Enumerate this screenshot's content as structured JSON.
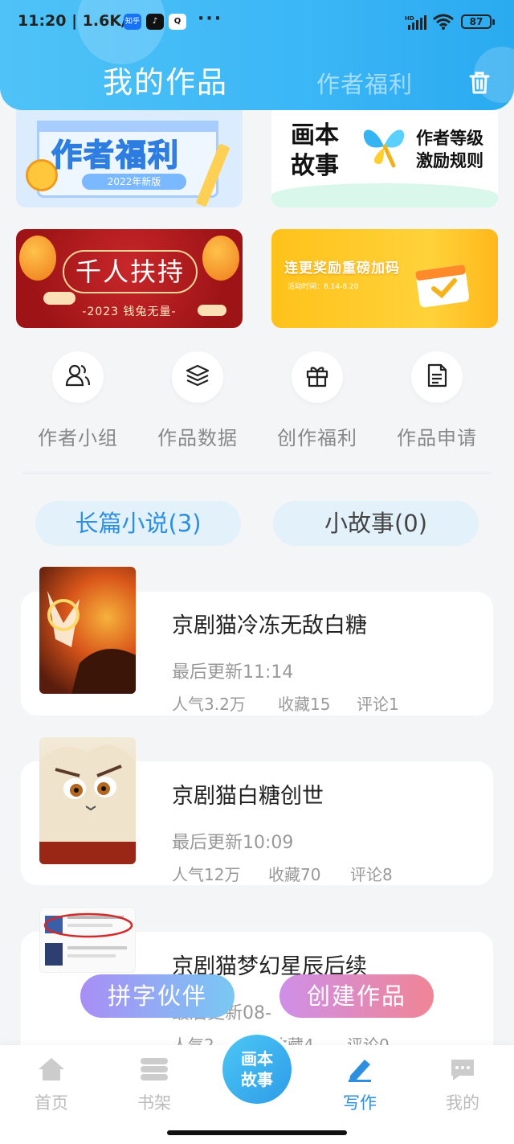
{
  "status_bar": {
    "time": "11:20",
    "speed": "1.6K/s",
    "app1": "知乎",
    "app2": "♪",
    "app3": "Q",
    "more": "···",
    "network": "HD",
    "battery": "87"
  },
  "header": {
    "tab_active": "我的作品",
    "tab_inactive": "作者福利"
  },
  "banners": {
    "b1": {
      "title": "作者福利",
      "sub": "2022年新版"
    },
    "b2": {
      "logo": "画本故事",
      "text_line1": "作者等级",
      "text_line2": "激励规则"
    },
    "b3": {
      "title": "千人扶持",
      "sub": "-2023 钱兔无量-"
    },
    "b4": {
      "title": "连更奖励重磅加码",
      "sub": "活动时间：8.14-8.20"
    }
  },
  "shortcuts": [
    {
      "label": "作者小组",
      "icon": "users-icon"
    },
    {
      "label": "作品数据",
      "icon": "layers-icon"
    },
    {
      "label": "创作福利",
      "icon": "gift-icon"
    },
    {
      "label": "作品申请",
      "icon": "document-icon"
    }
  ],
  "content_tabs": {
    "novel": "长篇小说(3)",
    "story": "小故事(0)"
  },
  "works": [
    {
      "title": "京剧猫冷冻无敌白糖",
      "update": "最后更新11:14",
      "popularity": "人气3.2万",
      "favorites": "收藏15",
      "comments": "评论1"
    },
    {
      "title": "京剧猫白糖创世",
      "update": "最后更新10:09",
      "popularity": "人气12万",
      "favorites": "收藏70",
      "comments": "评论8"
    },
    {
      "title": "京剧猫梦幻星辰后续",
      "update": "最后更新08-",
      "popularity": "人气2.",
      "favorites": "收藏4",
      "comments": "评论0"
    }
  ],
  "floating": {
    "partner": "拼字伙伴",
    "create": "创建作品"
  },
  "nav": {
    "home": "首页",
    "shelf": "书架",
    "center": "画本故事",
    "write": "写作",
    "mine": "我的"
  },
  "colors": {
    "accent": "#2d8fe0",
    "header": "#3bb6f6"
  }
}
